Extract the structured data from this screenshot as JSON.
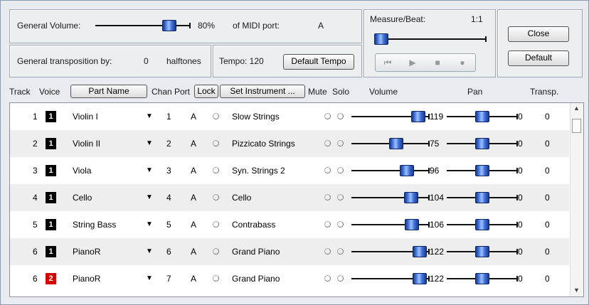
{
  "top": {
    "general_volume_label": "General Volume:",
    "general_volume_value": "80%",
    "general_volume_level": 0.8,
    "midi_port_label": "of MIDI port:",
    "midi_port_value": "A",
    "transposition_label": "General transposition by:",
    "transposition_value": "0",
    "transposition_unit": "halftones",
    "tempo_label": "Tempo: 120",
    "default_tempo_button": "Default Tempo",
    "measure_beat_label": "Measure/Beat:",
    "measure_beat_value": "1:1",
    "close_button": "Close",
    "default_button": "Default"
  },
  "header": {
    "track": "Track",
    "voice": "Voice",
    "part_name_button": "Part Name",
    "chan": "Chan",
    "port": "Port",
    "lock_button": "Lock",
    "set_instrument_button": "Set Instrument ...",
    "mute": "Mute",
    "solo": "Solo",
    "volume": "Volume",
    "pan": "Pan",
    "transp": "Transp."
  },
  "rows": [
    {
      "track": "1",
      "voice": "1",
      "voice_color": "#000000",
      "part": "Violin I",
      "chan": "1",
      "port": "A",
      "instrument": "Slow Strings",
      "volume": "119",
      "pan": "0",
      "transp": "0"
    },
    {
      "track": "2",
      "voice": "1",
      "voice_color": "#000000",
      "part": "Violin II",
      "chan": "2",
      "port": "A",
      "instrument": "Pizzicato Strings",
      "volume": "75",
      "pan": "0",
      "transp": "0"
    },
    {
      "track": "3",
      "voice": "1",
      "voice_color": "#000000",
      "part": "Viola",
      "chan": "3",
      "port": "A",
      "instrument": "Syn. Strings 2",
      "volume": "96",
      "pan": "0",
      "transp": "0"
    },
    {
      "track": "4",
      "voice": "1",
      "voice_color": "#000000",
      "part": "Cello",
      "chan": "4",
      "port": "A",
      "instrument": "Cello",
      "volume": "104",
      "pan": "0",
      "transp": "0"
    },
    {
      "track": "5",
      "voice": "1",
      "voice_color": "#000000",
      "part": "String Bass",
      "chan": "5",
      "port": "A",
      "instrument": "Contrabass",
      "volume": "106",
      "pan": "0",
      "transp": "0"
    },
    {
      "track": "6",
      "voice": "1",
      "voice_color": "#000000",
      "part": "PianoR",
      "chan": "6",
      "port": "A",
      "instrument": "Grand Piano",
      "volume": "122",
      "pan": "0",
      "transp": "0"
    },
    {
      "track": "6",
      "voice": "2",
      "voice_color": "#d40000",
      "part": "PianoR",
      "chan": "7",
      "port": "A",
      "instrument": "Grand Piano",
      "volume": "122",
      "pan": "0",
      "transp": "0"
    }
  ]
}
